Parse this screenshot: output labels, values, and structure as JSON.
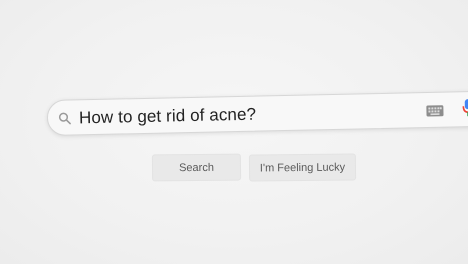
{
  "search": {
    "query": "How to get rid of acne?"
  },
  "buttons": {
    "search_label": "Search",
    "lucky_label": "I'm Feeling Lucky"
  },
  "icons": {
    "search": "magnifier-icon",
    "keyboard": "keyboard-icon",
    "mic": "microphone-icon"
  },
  "colors": {
    "mic_red": "#ea4335",
    "mic_blue": "#4285f4"
  }
}
